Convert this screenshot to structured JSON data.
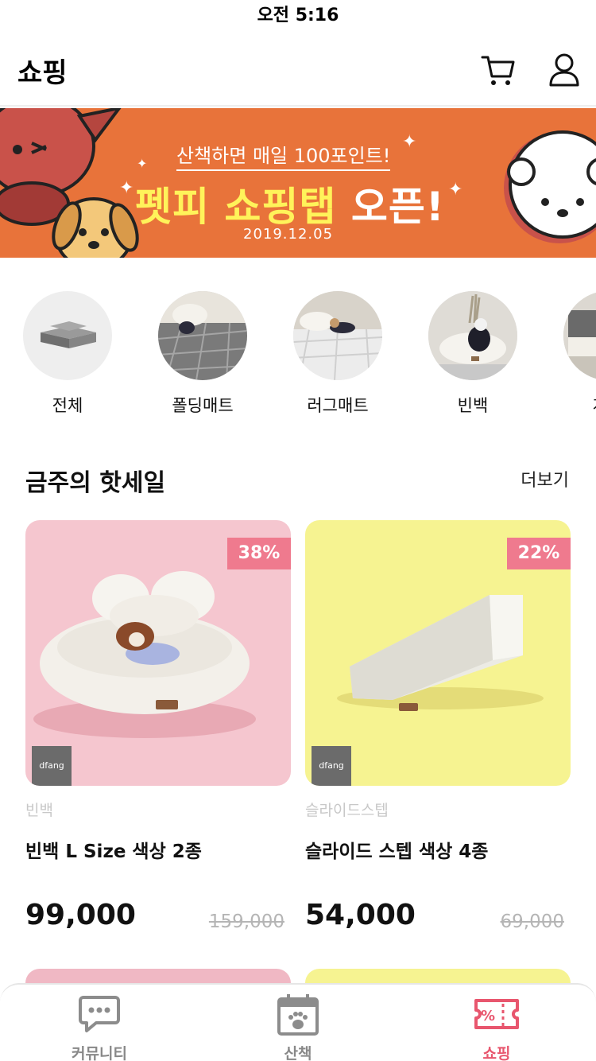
{
  "status_bar": {
    "time": "오전 5:16"
  },
  "header": {
    "title": "쇼핑",
    "cart_icon": "cart-icon",
    "profile_icon": "profile-icon"
  },
  "banner": {
    "subtitle": "산책하면 매일 100포인트!",
    "title_highlight": "펫피 쇼핑탭",
    "title_rest": "오픈!",
    "date": "2019.12.05",
    "colors": {
      "background": "#e8733a",
      "highlight": "#fff35a"
    }
  },
  "categories": [
    {
      "label": "전체"
    },
    {
      "label": "폴딩매트"
    },
    {
      "label": "러그매트"
    },
    {
      "label": "빈백"
    },
    {
      "label": "계단"
    }
  ],
  "hot_sale": {
    "title": "금주의 핫세일",
    "more": "더보기",
    "products": [
      {
        "category": "빈백",
        "name": "빈백 L Size 색상 2종",
        "price": "99,000",
        "original_price": "159,000",
        "discount": "38%",
        "brand": "dfang",
        "bg_color": "#f5c6cf"
      },
      {
        "category": "슬라이드스텝",
        "name": "슬라이드 스텝 색상 4종",
        "price": "54,000",
        "original_price": "69,000",
        "discount": "22%",
        "brand": "dfang",
        "bg_color": "#f6f391"
      }
    ]
  },
  "tab_bar": {
    "tabs": [
      {
        "label": "커뮤니티",
        "icon": "chat-bubble-icon"
      },
      {
        "label": "산책",
        "icon": "calendar-paw-icon"
      },
      {
        "label": "쇼핑",
        "icon": "coupon-icon",
        "active": true
      }
    ],
    "active_color": "#e8566e"
  },
  "accent_colors": {
    "discount_badge": "#ef7a8e"
  }
}
